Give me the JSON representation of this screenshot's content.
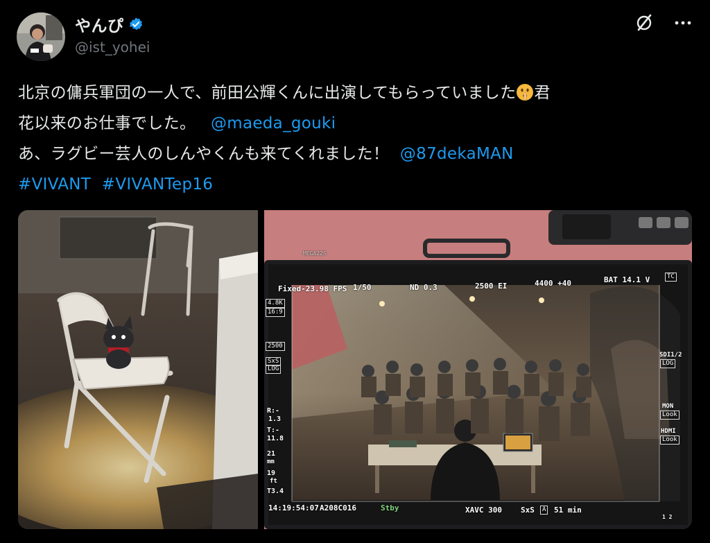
{
  "user": {
    "display_name": "やんぴ",
    "handle": "@ist_yohei",
    "verified": true,
    "avatar_icon": "avatar-photo"
  },
  "actions": {
    "grok_icon": "slash-circle-icon",
    "more_icon": "more-dots-icon"
  },
  "tweet": {
    "line1": "北京の傭兵軍団の一人で、前田公輝くんに出演してもらっていました",
    "line1_end": "君",
    "line2": "花以来のお仕事でした。",
    "mention1": "@maeda_gouki",
    "line3": "あ、ラグビー芸人のしんやくんも来てくれました！",
    "mention2": "@87dekaMAN",
    "hashtag1": "#VIVANT",
    "hashtag2": "#VIVANTep16",
    "emoji": "shushing-face-emoji"
  },
  "colors": {
    "background": "#000000",
    "text": "#e7e9ea",
    "secondary": "#71767b",
    "link": "#1d9bf0",
    "verified": "#1d9bf0"
  },
  "monitor": {
    "model": "MEGA22S",
    "top": {
      "fps": "Fixed-23.98 FPS",
      "shutter": "1/50",
      "nd": "ND 0.3",
      "iso": "2500 EI",
      "wb": "4400 +40",
      "bat": "BAT 14.1 V",
      "tc": "TC"
    },
    "left": {
      "res": "4.8K",
      "aspect": "16:9",
      "iso": "2500",
      "media": "SxS",
      "gamma": "LOG",
      "r_label": "R:-",
      "r_val": "1.3",
      "t_label": "T:-",
      "t_val": "11.8",
      "focal": "21",
      "focal_unit": "mm",
      "dist": "19",
      "dist_unit": "ft",
      "aperture": "T3.4"
    },
    "right": {
      "sdi": "SDI1/2",
      "sdi_mode": "LOG",
      "mon": "MON",
      "mon_mode": "Look",
      "hdmi": "HDMI",
      "hdmi_mode": "Look"
    },
    "bottom": {
      "timecode": "14:19:54:07",
      "clip": "A208C016",
      "status": "Stby",
      "codec": "XAVC 300",
      "card": "SxS",
      "slot": "A",
      "remaining": "51 min",
      "channels": "1 2"
    }
  }
}
